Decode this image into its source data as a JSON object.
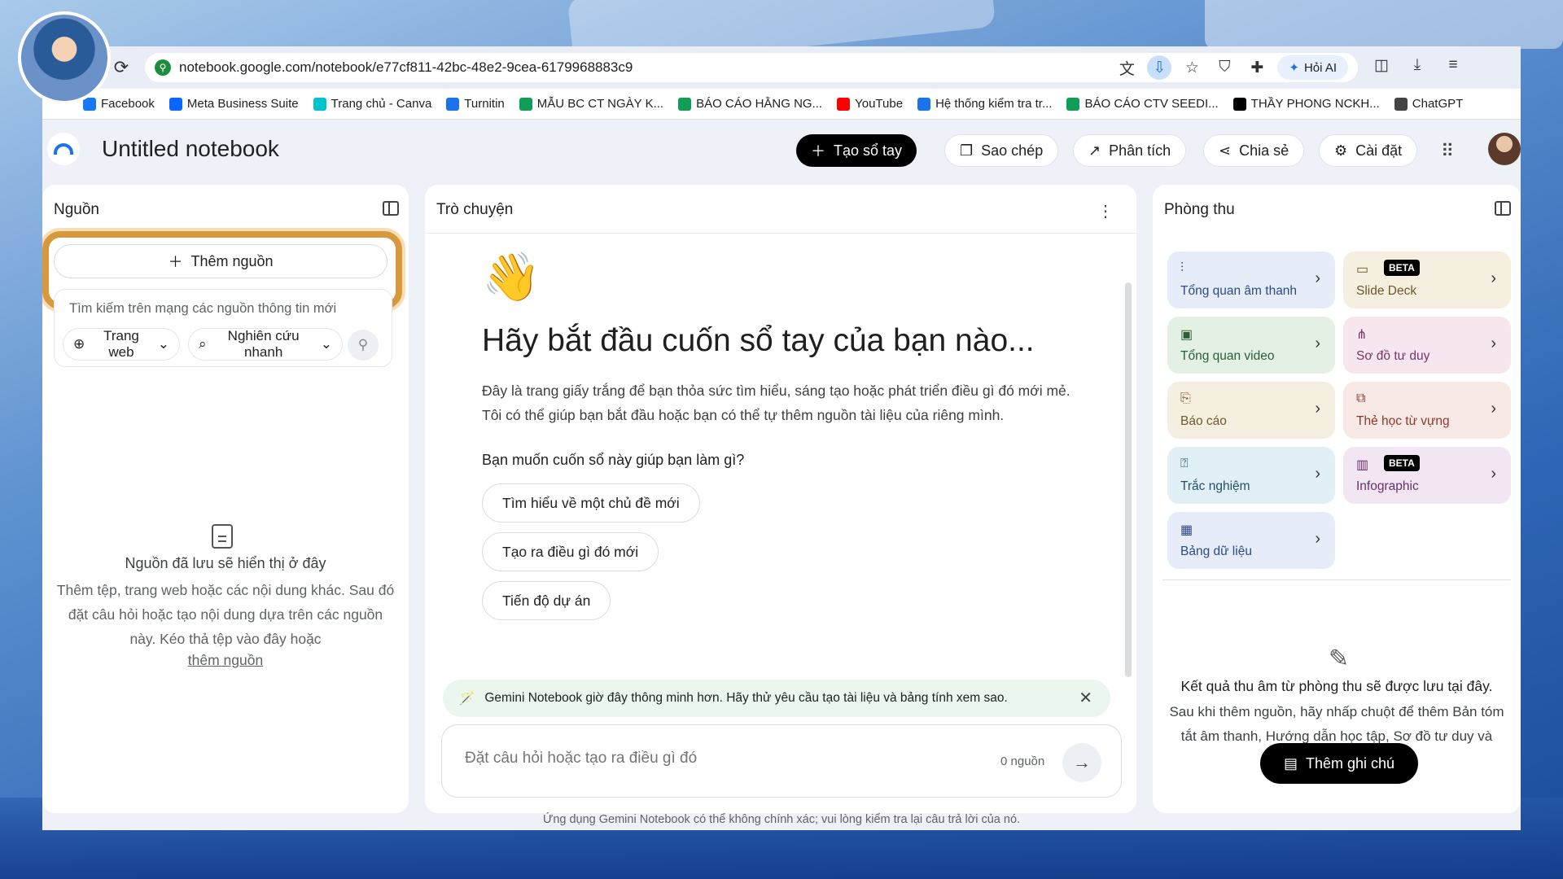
{
  "browser": {
    "url": "notebook.google.com/notebook/e77cf811-42bc-48e2-9cea-6179968883c9",
    "ai_label": "Hỏi AI"
  },
  "bookmarks": [
    {
      "label": "Facebook",
      "color": "#1877f2"
    },
    {
      "label": "Meta Business Suite",
      "color": "#0866ff"
    },
    {
      "label": "Trang chủ - Canva",
      "color": "#00c4cc"
    },
    {
      "label": "Turnitin",
      "color": "#1a73e8"
    },
    {
      "label": "MẪU BC CT NGÀY K...",
      "color": "#0f9d58"
    },
    {
      "label": "BÁO CÁO HẰNG NG...",
      "color": "#0f9d58"
    },
    {
      "label": "YouTube",
      "color": "#ff0000"
    },
    {
      "label": "Hệ thống kiểm tra tr...",
      "color": "#1a73e8"
    },
    {
      "label": "BÁO CÁO CTV SEEDI...",
      "color": "#0f9d58"
    },
    {
      "label": "THẦY PHONG NCKH...",
      "color": "#000000"
    },
    {
      "label": "ChatGPT",
      "color": "#444444"
    }
  ],
  "header": {
    "title": "Untitled notebook",
    "create_label": "Tạo sổ tay",
    "copy_label": "Sao chép",
    "analytics_label": "Phân tích",
    "share_label": "Chia sẻ",
    "settings_label": "Cài đặt"
  },
  "sources": {
    "title": "Nguồn",
    "add_label": "Thêm nguồn",
    "search_placeholder": "Tìm kiếm trên mạng các nguồn thông tin mới",
    "web_label": "Trang web",
    "research_label": "Nghiên cứu nhanh",
    "empty_title": "Nguồn đã lưu sẽ hiển thị ở đây",
    "empty_desc": "Thêm tệp, trang web hoặc các nội dung khác. Sau đó đặt câu hỏi hoặc tạo nội dung dựa trên các nguồn này. Kéo thả tệp vào đây hoặc",
    "empty_link": "thêm nguồn"
  },
  "chat": {
    "title": "Trò chuyện",
    "heading": "Hãy bắt đầu cuốn sổ tay của bạn nào...",
    "intro": "Đây là trang giấy trắng để bạn thỏa sức tìm hiểu, sáng tạo hoặc phát triển điều gì đó mới mẻ. Tôi có thể giúp bạn bắt đầu hoặc bạn có thể tự thêm nguồn tài liệu của riêng mình.",
    "question": "Bạn muốn cuốn sổ này giúp bạn làm gì?",
    "suggestions": [
      "Tìm hiểu về một chủ đề mới",
      "Tạo ra điều gì đó mới",
      "Tiến độ dự án"
    ],
    "banner": "Gemini Notebook giờ đây thông minh hơn. Hãy thử yêu cầu tạo tài liệu và bảng tính xem sao.",
    "input_placeholder": "Đặt câu hỏi hoặc tạo ra điều gì đó",
    "source_count": "0 nguồn"
  },
  "studio": {
    "title": "Phòng thu",
    "tiles": [
      {
        "label": "Tổng quan âm thanh",
        "icon": "audio-icon",
        "bg": "#e6ecf8",
        "fg": "#2d4b86",
        "beta": ""
      },
      {
        "label": "Slide Deck",
        "icon": "slides-icon",
        "bg": "#f5efe0",
        "fg": "#6b5a2e",
        "beta": "BETA"
      },
      {
        "label": "Tổng quan video",
        "icon": "video-icon",
        "bg": "#e3f1e5",
        "fg": "#2c5c36",
        "beta": ""
      },
      {
        "label": "Sơ đồ tư duy",
        "icon": "mindmap-icon",
        "bg": "#f6e6ef",
        "fg": "#7a3563",
        "beta": ""
      },
      {
        "label": "Báo cáo",
        "icon": "report-icon",
        "bg": "#f5efe0",
        "fg": "#6b5a2e",
        "beta": ""
      },
      {
        "label": "Thẻ học từ vựng",
        "icon": "flashcard-icon",
        "bg": "#f8e8e6",
        "fg": "#8a3a2c",
        "beta": ""
      },
      {
        "label": "Trắc nghiệm",
        "icon": "quiz-icon",
        "bg": "#e1f0f7",
        "fg": "#24506a",
        "beta": ""
      },
      {
        "label": "Infographic",
        "icon": "infographic-icon",
        "bg": "#f3e6f3",
        "fg": "#6a2f6a",
        "beta": "BETA"
      },
      {
        "label": "Bảng dữ liệu",
        "icon": "table-icon",
        "bg": "#e6ecf8",
        "fg": "#2d4b86",
        "beta": ""
      }
    ],
    "result_title": "Kết quả thu âm từ phòng thu sẽ được lưu tại đây.",
    "result_desc": "Sau khi thêm nguồn, hãy nhấp chuột để thêm Bản tóm tắt âm thanh, Hướng dẫn học tập, Sơ đồ tư duy và nhiều nội dung khác!",
    "note_label": "Thêm ghi chú"
  },
  "disclaimer": "Ứng dụng Gemini Notebook có thể không chính xác; vui lòng kiểm tra lại câu trả lời của nó."
}
